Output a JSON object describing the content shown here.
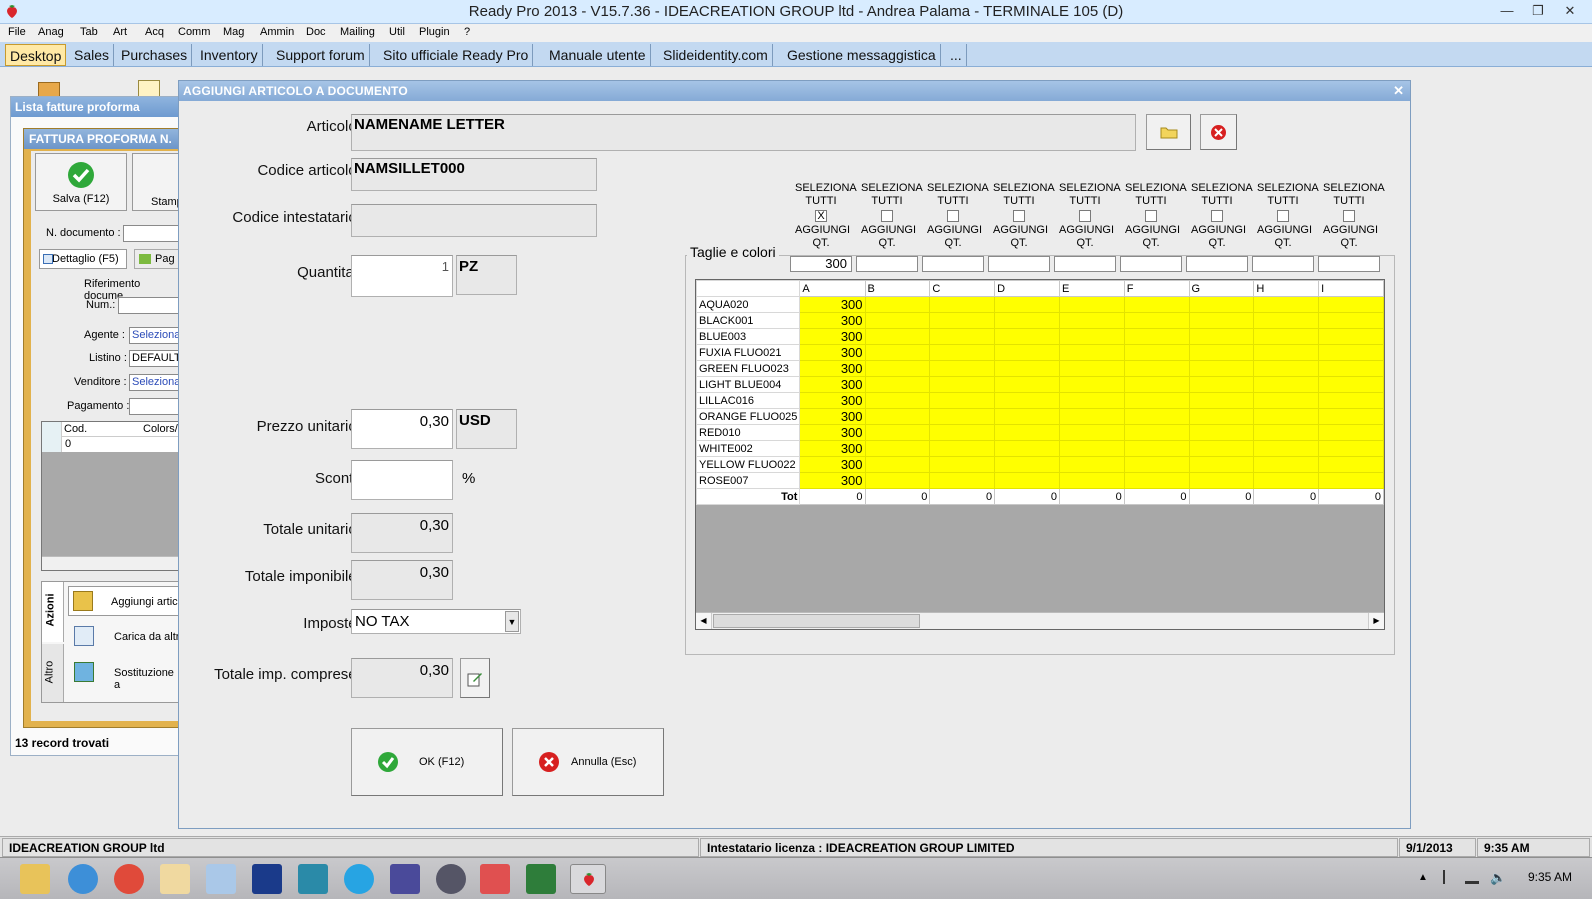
{
  "window": {
    "title": "Ready Pro 2013 - V15.7.36 - IDEACREATION GROUP ltd - Andrea Palama - TERMINALE 105 (D)"
  },
  "menu": [
    "File",
    "Anag",
    "Tab",
    "Art",
    "Acq",
    "Comm",
    "Mag",
    "Ammin",
    "Doc",
    "Mailing",
    "Util",
    "Plugin",
    "?"
  ],
  "tabs": [
    "Desktop",
    "Sales",
    "Purchases",
    "Inventory",
    "Support forum",
    "Sito ufficiale Ready Pro",
    "Manuale utente",
    "Slideidentity.com",
    "Gestione messaggistica",
    "..."
  ],
  "background": {
    "lista_title": "Lista fatture proforma",
    "fattura_title": "FATTURA PROFORMA N.",
    "salva": "Salva (F12)",
    "stamp": "Stamp",
    "n_documento": "N. documento :",
    "dettaglio_tab": "Dettaglio (F5)",
    "pag_tab": "Pag",
    "riferimento": "Riferimento docume",
    "num": "Num.:",
    "agente": "Agente :",
    "agente_val": "Seleziona",
    "listino": "Listino :",
    "listino_val": "DEFAULT",
    "venditore": "Venditore :",
    "venditore_val": "Seleziona",
    "pagamento": "Pagamento :",
    "col_cod": "Cod.",
    "col_colors": "Colors/",
    "row0": "0",
    "azioni": "Azioni",
    "altro": "Altro",
    "aggiungi": "Aggiungi artic",
    "carica": "Carica da altr",
    "sostituzione": "Sostituzione a",
    "records": "13 record trovati"
  },
  "dialog": {
    "title": "AGGIUNGI ARTICOLO A DOCUMENTO",
    "labels": {
      "articolo": "Articolo :",
      "codice_articolo": "Codice articolo :",
      "codice_intestatario": "Codice intestatario :",
      "quantita": "Quantita' :",
      "prezzo": "Prezzo unitario :",
      "sconti": "Sconti :",
      "totale_unitario": "Totale unitario :",
      "totale_imponibile": "Totale imponibile :",
      "imposte": "Imposte :",
      "totale_imp": "Totale imp. comprese :"
    },
    "values": {
      "articolo": "NAMENAME LETTER",
      "codice_articolo": "NAMSILLET000",
      "codice_intestatario": "",
      "quantita": "1",
      "unit": "PZ",
      "prezzo": "0,30",
      "currency": "USD",
      "sconti": "",
      "percent": "%",
      "totale_unitario": "0,30",
      "totale_imponibile": "0,30",
      "imposte": "NO TAX",
      "totale_imp": "0,30"
    },
    "ok_button": "OK (F12)",
    "cancel_button": "Annulla (Esc)",
    "taglie_label": "Taglie e colori",
    "select_all": "SELEZIONA TUTTI",
    "add_qty": "AGGIUNGI QT.",
    "columns": [
      {
        "name": "A",
        "qty": "300",
        "checked": true
      },
      {
        "name": "B",
        "qty": "",
        "checked": false
      },
      {
        "name": "C",
        "qty": "",
        "checked": false
      },
      {
        "name": "D",
        "qty": "",
        "checked": false
      },
      {
        "name": "E",
        "qty": "",
        "checked": false
      },
      {
        "name": "F",
        "qty": "",
        "checked": false
      },
      {
        "name": "G",
        "qty": "",
        "checked": false
      },
      {
        "name": "H",
        "qty": "",
        "checked": false
      },
      {
        "name": "I",
        "qty": "",
        "checked": false
      }
    ],
    "rows": [
      {
        "name": "AQUA020",
        "a": "300"
      },
      {
        "name": "BLACK001",
        "a": "300"
      },
      {
        "name": "BLUE003",
        "a": "300"
      },
      {
        "name": "FUXIA FLUO021",
        "a": "300"
      },
      {
        "name": "GREEN FLUO023",
        "a": "300"
      },
      {
        "name": "LIGHT BLUE004",
        "a": "300"
      },
      {
        "name": "LILLAC016",
        "a": "300"
      },
      {
        "name": "ORANGE FLUO025",
        "a": "300"
      },
      {
        "name": "RED010",
        "a": "300"
      },
      {
        "name": "WHITE002",
        "a": "300"
      },
      {
        "name": "YELLOW  FLUO022",
        "a": "300"
      },
      {
        "name": "ROSE007",
        "a": "300"
      }
    ],
    "tot_label": "Tot",
    "totals": [
      "0",
      "0",
      "0",
      "0",
      "0",
      "0",
      "0",
      "0",
      "0"
    ]
  },
  "status": {
    "company": "IDEACREATION GROUP ltd",
    "license": "Intestatario licenza : IDEACREATION GROUP LIMITED",
    "date": "9/1/2013",
    "time": "9:35 AM"
  },
  "taskbar": {
    "clock": "9:35 AM"
  },
  "colors": {
    "grid_fill": "#ffff00",
    "active_tab": "#ffe9a6",
    "caption": "#85aad6"
  }
}
